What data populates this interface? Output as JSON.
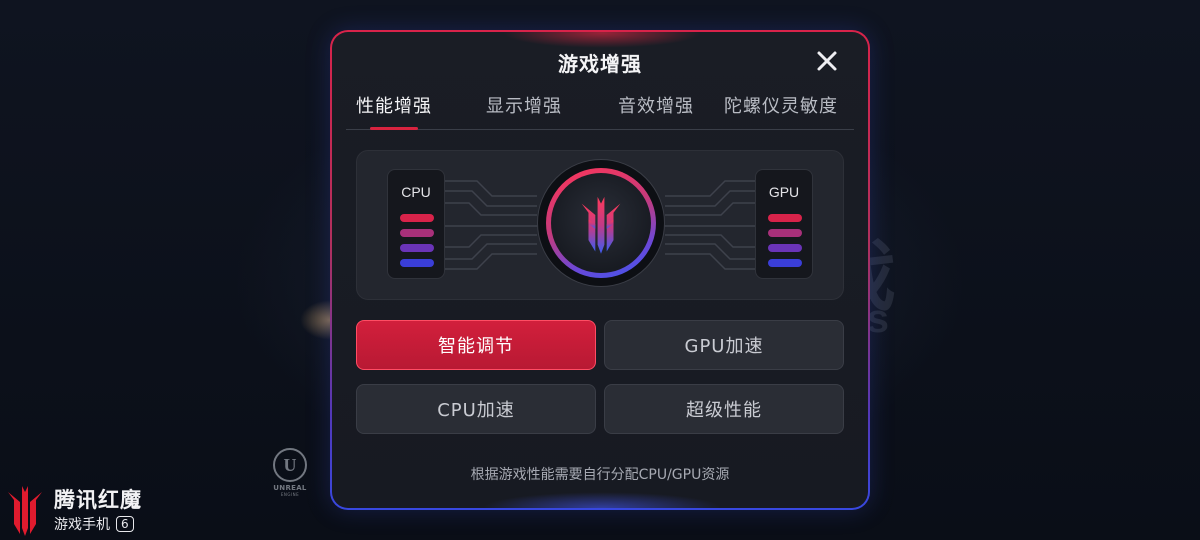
{
  "background": {
    "watermark_cn": "戏",
    "watermark_en": "es",
    "engine_logo": {
      "letter": "U",
      "word": "UNREAL",
      "sub": "ENGINE"
    }
  },
  "brand": {
    "icon": "red-magic-logo-icon",
    "title": "腾讯红魔",
    "subtitle": "游戏手机",
    "badge": "6"
  },
  "dialog": {
    "title": "游戏增强",
    "close_icon": "close-icon",
    "tabs": [
      {
        "label": "性能增强",
        "active": true
      },
      {
        "label": "显示增强",
        "active": false
      },
      {
        "label": "音效增强",
        "active": false
      },
      {
        "label": "陀螺仪灵敏度",
        "active": false
      }
    ],
    "visual": {
      "left_chip": "CPU",
      "right_chip": "GPU",
      "bar_colors": [
        "#d8234a",
        "#a8307a",
        "#6a34b8",
        "#3a3ed8"
      ],
      "center_icon": "red-magic-logo-icon"
    },
    "modes": [
      {
        "label": "智能调节",
        "active": true
      },
      {
        "label": "GPU加速",
        "active": false
      },
      {
        "label": "CPU加速",
        "active": false
      },
      {
        "label": "超级性能",
        "active": false
      }
    ],
    "hint": "根据游戏性能需要自行分配CPU/GPU资源"
  },
  "colors": {
    "accent": "#d21f3c",
    "border_top": "#d8234a",
    "border_bottom": "#3848e0",
    "panel": "#1a1d25"
  }
}
